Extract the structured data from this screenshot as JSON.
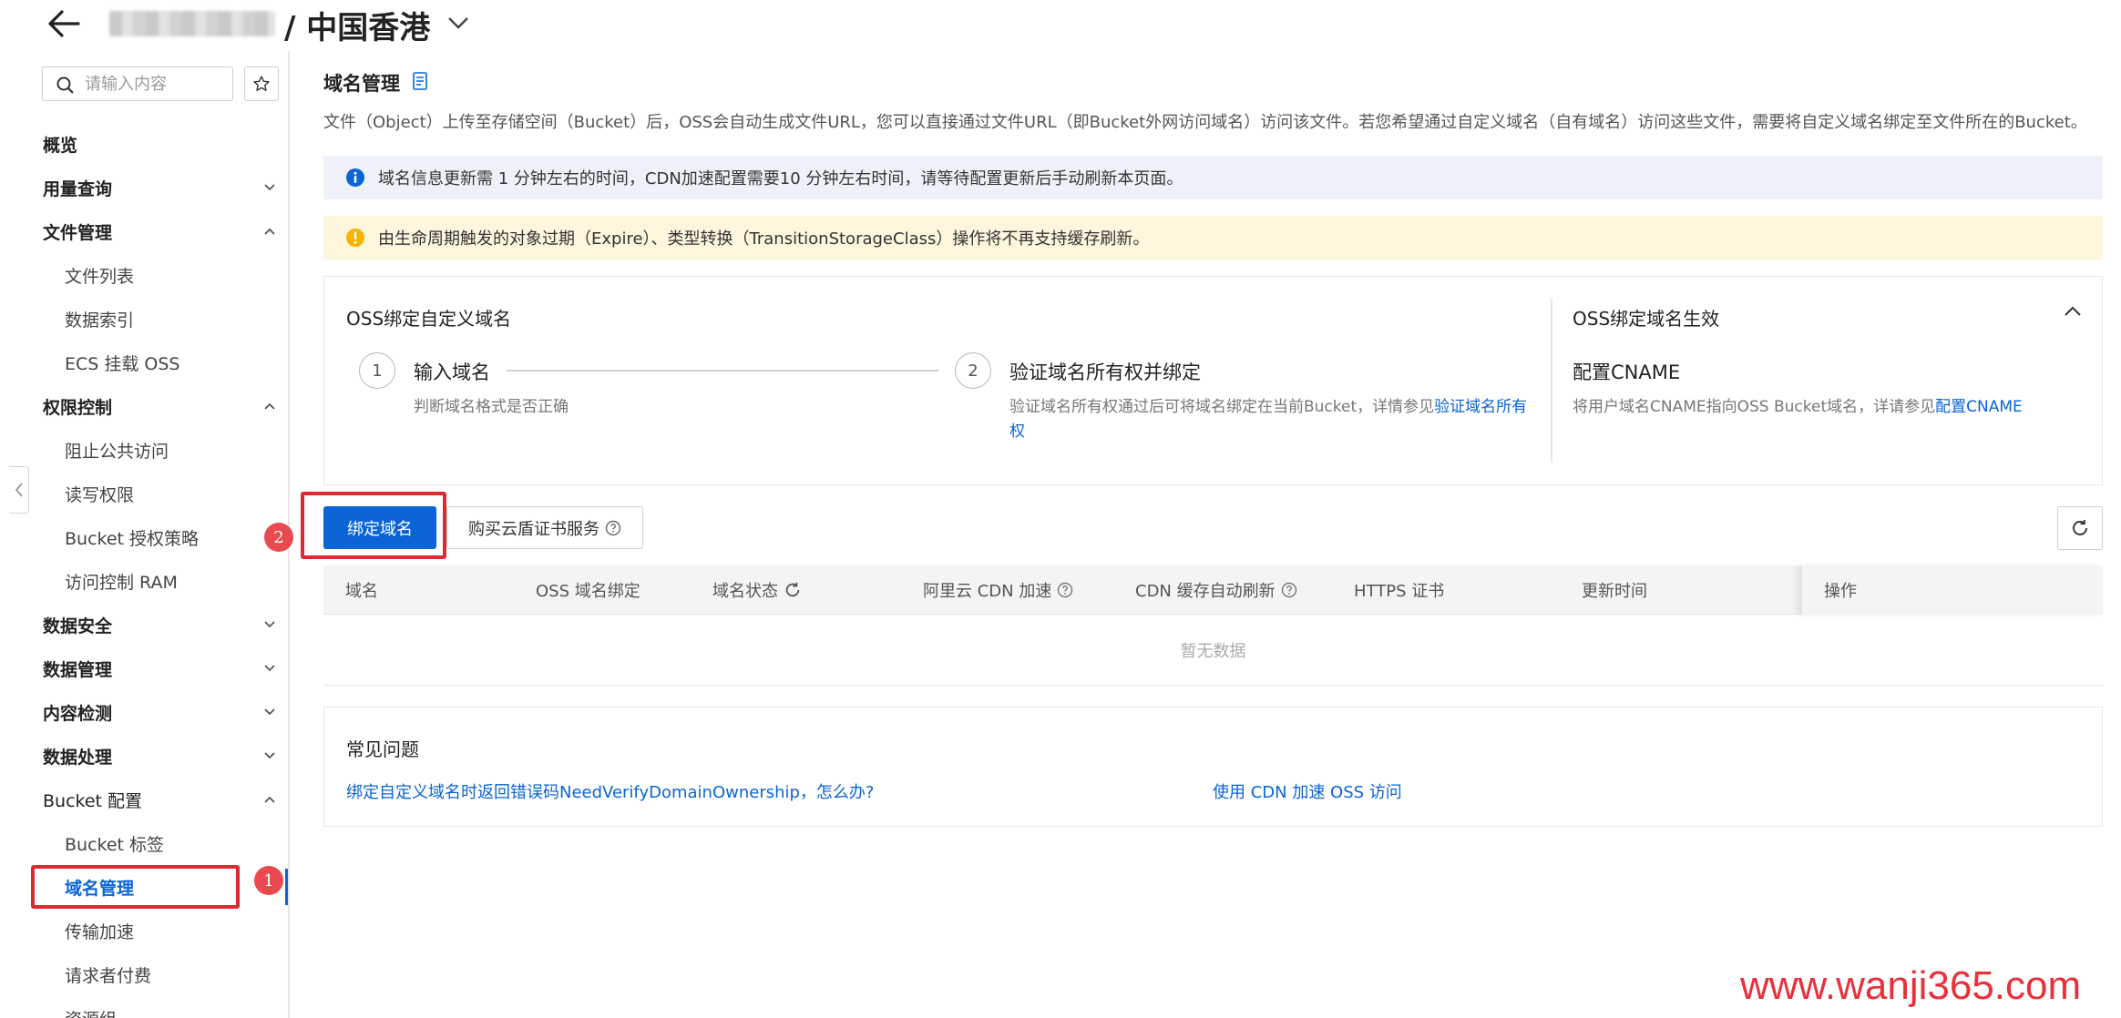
{
  "header": {
    "title": "/ 中国香港"
  },
  "sidebar": {
    "search_placeholder": "请输入内容",
    "items": [
      {
        "label": "概览"
      },
      {
        "label": "用量查询"
      },
      {
        "label": "文件管理"
      },
      {
        "label": "文件列表"
      },
      {
        "label": "数据索引"
      },
      {
        "label": "ECS 挂载 OSS"
      },
      {
        "label": "权限控制"
      },
      {
        "label": "阻止公共访问"
      },
      {
        "label": "读写权限"
      },
      {
        "label": "Bucket 授权策略"
      },
      {
        "label": "访问控制 RAM"
      },
      {
        "label": "数据安全"
      },
      {
        "label": "数据管理"
      },
      {
        "label": "内容检测"
      },
      {
        "label": "数据处理"
      },
      {
        "label": "Bucket 配置"
      },
      {
        "label": "Bucket 标签"
      },
      {
        "label": "域名管理"
      },
      {
        "label": "传输加速"
      },
      {
        "label": "请求者付费"
      },
      {
        "label": "资源组"
      }
    ]
  },
  "annotations": {
    "marker1": "1",
    "marker2": "2"
  },
  "main": {
    "title": "域名管理",
    "description": "文件（Object）上传至存储空间（Bucket）后，OSS会自动生成文件URL，您可以直接通过文件URL（即Bucket外网访问域名）访问该文件。若您希望通过自定义域名（自有域名）访问这些文件，需要将自定义域名绑定至文件所在的Bucket。",
    "info_alert": "域名信息更新需 1 分钟左右的时间，CDN加速配置需要10 分钟左右时间，请等待配置更新后手动刷新本页面。",
    "warn_alert": "由生命周期触发的对象过期（Expire）、类型转换（TransitionStorageClass）操作将不再支持缓存刷新。",
    "guide": {
      "left_title": "OSS绑定自定义域名",
      "step1": {
        "num": "1",
        "title": "输入域名",
        "desc": "判断域名格式是否正确"
      },
      "step2": {
        "num": "2",
        "title": "验证域名所有权并绑定",
        "desc": "验证域名所有权通过后可将域名绑定在当前Bucket，详情参见",
        "link": "验证域名所有权"
      },
      "right_title": "OSS绑定域名生效",
      "right_sub": "配置CNAME",
      "right_desc": "将用户域名CNAME指向OSS Bucket域名，详请参见",
      "right_link": "配置CNAME"
    },
    "buttons": {
      "bind": "绑定域名",
      "buy_cert": "购买云盾证书服务"
    },
    "table": {
      "columns": [
        "域名",
        "OSS 域名绑定",
        "域名状态",
        "阿里云 CDN 加速",
        "CDN 缓存自动刷新",
        "HTTPS 证书",
        "更新时间",
        "操作"
      ],
      "empty": "暂无数据"
    },
    "faq": {
      "title": "常见问题",
      "links": [
        "绑定自定义域名时返回错误码NeedVerifyDomainOwnership，怎么办?",
        "使用 CDN 加速 OSS 访问"
      ]
    }
  },
  "watermark": "www.wanji365.com",
  "colors": {
    "primary": "#0a64d6",
    "annotation_red": "#e0282e",
    "info_bg": "#eef2f8",
    "warn_bg": "#fdf6dd",
    "warn_icon": "#f5b400"
  }
}
